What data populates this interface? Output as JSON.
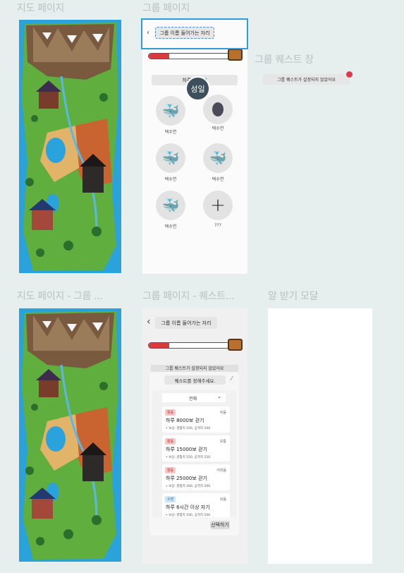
{
  "frames": {
    "map_page": "지도 페이지",
    "group_page": "그룹 페이지",
    "group_quest_window": "그룹 퀘스트 창",
    "map_page_group": "지도 페이지 - 그룹 ...",
    "group_page_quest": "그룹 페이지 - 퀘스트...",
    "notification_modal": "알 받기 모달"
  },
  "group_page": {
    "group_name_slot": "그룹 이름 들어가는 자리",
    "progress_percent": 25,
    "daily_quest_bar": "하루 2... 기",
    "streak_badge": "성일",
    "members": [
      {
        "name": "텍수연",
        "avatar": "whale-icon"
      },
      {
        "name": "텍수연",
        "avatar": "egg-icon"
      },
      {
        "name": "텍수연",
        "avatar": "whale-icon"
      },
      {
        "name": "텍수연",
        "avatar": "whale-icon"
      },
      {
        "name": "텍수연",
        "avatar": "whale-icon"
      },
      {
        "name": "???",
        "avatar": "plus-icon"
      }
    ]
  },
  "quest_window": {
    "notice": "그룹 퀘스트가 설정되지 않았어요",
    "alert_color": "#e0384a"
  },
  "quest_page": {
    "group_name_slot": "그룹 이름 들어가는 자리",
    "progress_percent": 25,
    "behind_banner": "그룹 퀘스트가 설정되지 않았어요",
    "modal_title": "퀘스트를 정해주세요.",
    "filter_selected": "전체",
    "quests": [
      {
        "tag": "활동",
        "tag_color": "#f3c9c9",
        "difficulty": "쉬움",
        "title": "하루 8000보 걷기",
        "reward": "• 보상: 경험치 100, 공격치 100"
      },
      {
        "tag": "활동",
        "tag_color": "#f3c9c9",
        "difficulty": "보통",
        "title": "하루 15000보 걷기",
        "reward": "• 보상: 경험치 150, 공격치 150"
      },
      {
        "tag": "활동",
        "tag_color": "#f3c9c9",
        "difficulty": "어려움",
        "title": "하루 25000보 걷기",
        "reward": "• 보상: 경험치 200, 공격치 200"
      },
      {
        "tag": "수면",
        "tag_color": "#cfe6f7",
        "difficulty": "쉬움",
        "title": "하루 6시간 이상 자기",
        "reward": "• 보상: 경험치 100, 공격치 100"
      }
    ],
    "select_button": "선택하기"
  }
}
